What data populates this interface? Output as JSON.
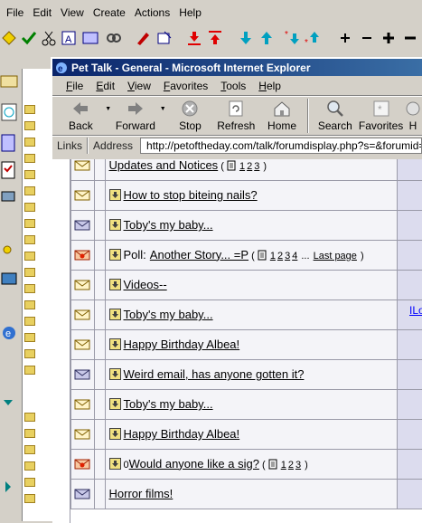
{
  "back_app": {
    "menu": [
      "File",
      "Edit",
      "View",
      "Create",
      "Actions",
      "Help"
    ]
  },
  "ie": {
    "title": "Pet Talk - General - Microsoft Internet Explorer",
    "menu": [
      "File",
      "Edit",
      "View",
      "Favorites",
      "Tools",
      "Help"
    ],
    "toolbar": {
      "back": "Back",
      "forward": "Forward",
      "stop": "Stop",
      "refresh": "Refresh",
      "home": "Home",
      "search": "Search",
      "favorites": "Favorites",
      "history_partial": "H"
    },
    "links_label": "Links",
    "address_label": "Address",
    "url": "http://petoftheday.com/talk/forumdisplay.php?s=&forumid=27"
  },
  "threads": [
    {
      "icon": "envelope-read-icon",
      "title": "Updates and Notices",
      "pages": [
        "1",
        "2",
        "3"
      ],
      "last": "",
      "arrow": false
    },
    {
      "icon": "envelope-read-icon",
      "title": "How to stop biteing nails?",
      "pages": [],
      "last": "",
      "arrow": true
    },
    {
      "icon": "envelope-new-icon",
      "title": "Toby's my baby...",
      "pages": [],
      "last": "",
      "arrow": true
    },
    {
      "icon": "envelope-hot-icon",
      "prefix": "Poll:",
      "title": "Another Story... =P",
      "pages": [
        "1",
        "2",
        "3",
        "4"
      ],
      "last": "Last page",
      "arrow": true
    },
    {
      "icon": "envelope-read-icon",
      "title": "Videos--",
      "pages": [],
      "last": "",
      "arrow": true
    },
    {
      "icon": "envelope-read-icon",
      "title": "Toby's my baby...",
      "pages": [],
      "last": "",
      "arrow": true
    },
    {
      "icon": "envelope-read-icon",
      "title": "Happy Birthday Albea!",
      "pages": [],
      "last": "",
      "arrow": true
    },
    {
      "icon": "envelope-new-icon",
      "title": "Weird email, has anyone gotten it?",
      "pages": [],
      "last": "",
      "arrow": true
    },
    {
      "icon": "envelope-read-icon",
      "title": "Toby's my baby...",
      "pages": [],
      "last": "",
      "arrow": true
    },
    {
      "icon": "envelope-read-icon",
      "title": "Happy Birthday Albea!",
      "pages": [],
      "last": "",
      "arrow": true
    },
    {
      "icon": "envelope-hot-icon",
      "title": "Would anyone like a sig?",
      "pages": [
        "1",
        "2",
        "3"
      ],
      "last": "",
      "arrow": true,
      "attach": true
    },
    {
      "icon": "envelope-new-icon",
      "title": "Horror films!",
      "pages": [],
      "last": "",
      "arrow": false
    }
  ],
  "right_column": {
    "partial_text": "ILo"
  },
  "colors": {
    "title_bar_start": "#0a246a",
    "title_bar_end": "#3a6ea5",
    "row_bg": "#f4f4f8",
    "right_col_bg": "#dcdcee"
  }
}
